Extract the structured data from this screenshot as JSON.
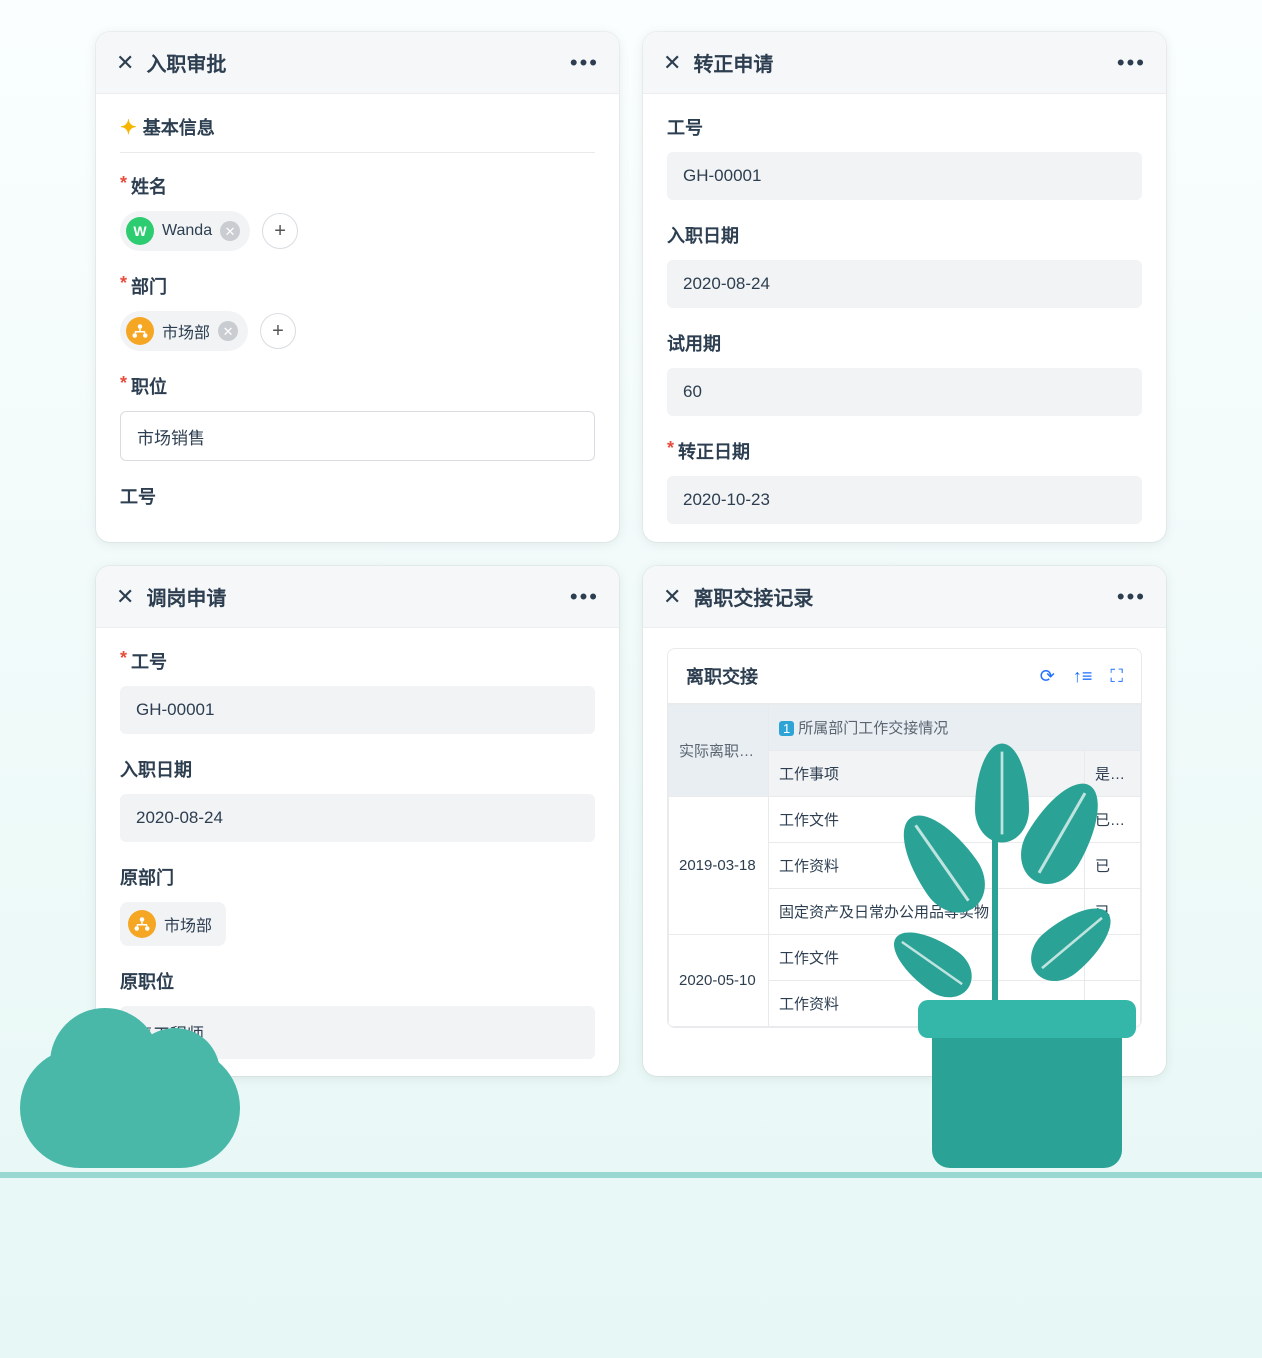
{
  "card1": {
    "title": "入职审批",
    "section": "基本信息",
    "name": {
      "label": "姓名",
      "chip_text": "Wanda",
      "chip_initial": "W"
    },
    "dept": {
      "label": "部门",
      "chip_text": "市场部"
    },
    "position": {
      "label": "职位",
      "value": "市场销售"
    },
    "empno": {
      "label": "工号"
    }
  },
  "card2": {
    "title": "转正申请",
    "empno": {
      "label": "工号",
      "value": "GH-00001"
    },
    "hiredate": {
      "label": "入职日期",
      "value": "2020-08-24"
    },
    "probation": {
      "label": "试用期",
      "value": "60"
    },
    "regulardate": {
      "label": "转正日期",
      "value": "2020-10-23"
    }
  },
  "card3": {
    "title": "调岗申请",
    "empno": {
      "label": "工号",
      "value": "GH-00001"
    },
    "hiredate": {
      "label": "入职日期",
      "value": "2020-08-24"
    },
    "origdept": {
      "label": "原部门",
      "chip_text": "市场部"
    },
    "origpos": {
      "label": "原职位",
      "value": "售工程师"
    }
  },
  "card4": {
    "title": "离职交接记录",
    "sub_title": "离职交接",
    "table": {
      "col_date": "实际离职...",
      "group_header": "所属部门工作交接情况",
      "col_item": "工作事项",
      "col_status": "是否...",
      "rows": [
        {
          "date": "2019-03-18",
          "items": [
            {
              "item": "工作文件",
              "status": "已办理"
            },
            {
              "item": "工作资料",
              "status": "已"
            },
            {
              "item": "固定资产及日常办公用品等实物",
              "status": "已"
            }
          ]
        },
        {
          "date": "2020-05-10",
          "items": [
            {
              "item": "工作文件",
              "status": ""
            },
            {
              "item": "工作资料",
              "status": ""
            }
          ]
        }
      ]
    }
  }
}
